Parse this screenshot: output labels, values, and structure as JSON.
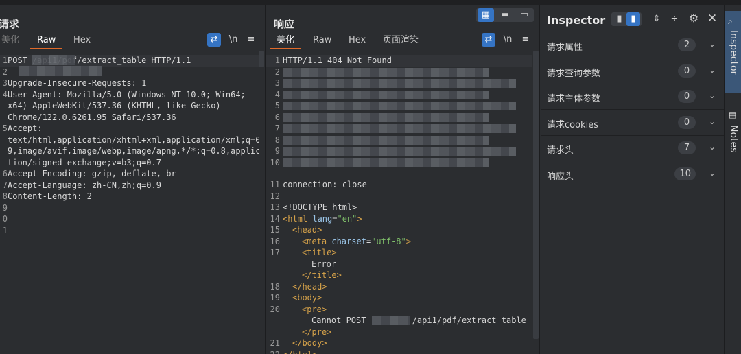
{
  "request": {
    "title": "请求",
    "tabs": [
      "美化",
      "Raw",
      "Hex"
    ],
    "active_tab": "Raw",
    "tool_wrap": "⇄",
    "tool_newline": "\\n",
    "tool_menu": "≡",
    "lines": [
      {
        "n": "1",
        "text": "POST /api1/pdf/extract_table HTTP/1.1"
      },
      {
        "n": "2",
        "text": ""
      },
      {
        "n": "3",
        "text": "Upgrade-Insecure-Requests: 1"
      },
      {
        "n": "4",
        "text": "User-Agent: Mozilla/5.0 (Windows NT 10.0; Win64;"
      },
      {
        "n": "",
        "text": "x64) AppleWebKit/537.36 (KHTML, like Gecko)"
      },
      {
        "n": "",
        "text": "Chrome/122.0.6261.95 Safari/537.36"
      },
      {
        "n": "5",
        "text": "Accept:"
      },
      {
        "n": "",
        "text": "text/html,application/xhtml+xml,application/xml;q=0."
      },
      {
        "n": "",
        "text": "9,image/avif,image/webp,image/apng,*/*;q=0.8,applica"
      },
      {
        "n": "",
        "text": "tion/signed-exchange;v=b3;q=0.7"
      },
      {
        "n": "6",
        "text": "Accept-Encoding: gzip, deflate, br"
      },
      {
        "n": "7",
        "text": "Accept-Language: zh-CN,zh;q=0.9"
      },
      {
        "n": "8",
        "text": "Content-Length: 2"
      },
      {
        "n": "9",
        "text": ""
      },
      {
        "n": "0",
        "text": ""
      },
      {
        "n": "1",
        "text": ""
      }
    ]
  },
  "response": {
    "title": "响应",
    "tabs": [
      "美化",
      "Raw",
      "Hex",
      "页面渲染"
    ],
    "active_tab": "美化",
    "tool_wrap": "⇄",
    "tool_newline": "\\n",
    "tool_menu": "≡",
    "status_line": "HTTP/1.1 404 Not Found",
    "redacted_line_numbers": [
      "2",
      "3",
      "4",
      "5",
      "6",
      "7",
      "8",
      "9",
      "10"
    ],
    "line11": {
      "n": "11",
      "key": "connection",
      "value": ": close"
    },
    "html_lines": [
      {
        "n": "12",
        "indent": 0,
        "parts": []
      },
      {
        "n": "13",
        "indent": 0,
        "parts": [
          [
            "t",
            "<!DOCTYPE html>"
          ]
        ]
      },
      {
        "n": "14",
        "indent": 0,
        "parts": [
          [
            "g",
            "<html "
          ],
          [
            "a",
            "lang"
          ],
          [
            "t",
            "="
          ],
          [
            "v",
            "\"en\""
          ],
          [
            "g",
            ">"
          ]
        ]
      },
      {
        "n": "15",
        "indent": 1,
        "parts": [
          [
            "g",
            "<head>"
          ]
        ]
      },
      {
        "n": "16",
        "indent": 2,
        "parts": [
          [
            "g",
            "<meta "
          ],
          [
            "a",
            "charset"
          ],
          [
            "t",
            "="
          ],
          [
            "v",
            "\"utf-8\""
          ],
          [
            "g",
            ">"
          ]
        ]
      },
      {
        "n": "17",
        "indent": 2,
        "parts": [
          [
            "g",
            "<title>"
          ]
        ]
      },
      {
        "n": "",
        "indent": 3,
        "parts": [
          [
            "t",
            "Error"
          ]
        ]
      },
      {
        "n": "",
        "indent": 2,
        "parts": [
          [
            "g",
            "</title>"
          ]
        ]
      },
      {
        "n": "18",
        "indent": 1,
        "parts": [
          [
            "g",
            "</head>"
          ]
        ]
      },
      {
        "n": "19",
        "indent": 1,
        "parts": [
          [
            "g",
            "<body>"
          ]
        ]
      },
      {
        "n": "20",
        "indent": 2,
        "parts": [
          [
            "g",
            "<pre>"
          ]
        ]
      },
      {
        "n": "",
        "indent": 3,
        "parts": [
          [
            "t",
            "Cannot POST "
          ],
          [
            "t",
            "/api1/pdf/extract_table"
          ]
        ]
      },
      {
        "n": "",
        "indent": 2,
        "parts": [
          [
            "g",
            "</pre>"
          ]
        ]
      },
      {
        "n": "21",
        "indent": 1,
        "parts": [
          [
            "g",
            "</body>"
          ]
        ]
      },
      {
        "n": "22",
        "indent": 0,
        "parts": [
          [
            "g",
            "</html>"
          ]
        ]
      }
    ]
  },
  "inspector": {
    "title": "Inspector",
    "rows": [
      {
        "label": "请求属性",
        "count": "2"
      },
      {
        "label": "请求查询参数",
        "count": "0"
      },
      {
        "label": "请求主体参数",
        "count": "0"
      },
      {
        "label": "请求cookies",
        "count": "0"
      },
      {
        "label": "请求头",
        "count": "7"
      },
      {
        "label": "响应头",
        "count": "10"
      }
    ]
  },
  "side_rail": {
    "tabs": [
      "Inspector",
      "Notes"
    ]
  },
  "icons": {
    "layout_split": "layout-split-icon",
    "layout_h": "layout-horizontal-icon",
    "layout_v": "layout-vertical-icon",
    "settings": "gear-icon",
    "close": "close-icon"
  },
  "colors": {
    "accent": "#e06a2a",
    "blue": "#3574c4",
    "tag": "#d7a34a",
    "attr": "#9cc7ea",
    "value": "#7fbf6a"
  }
}
